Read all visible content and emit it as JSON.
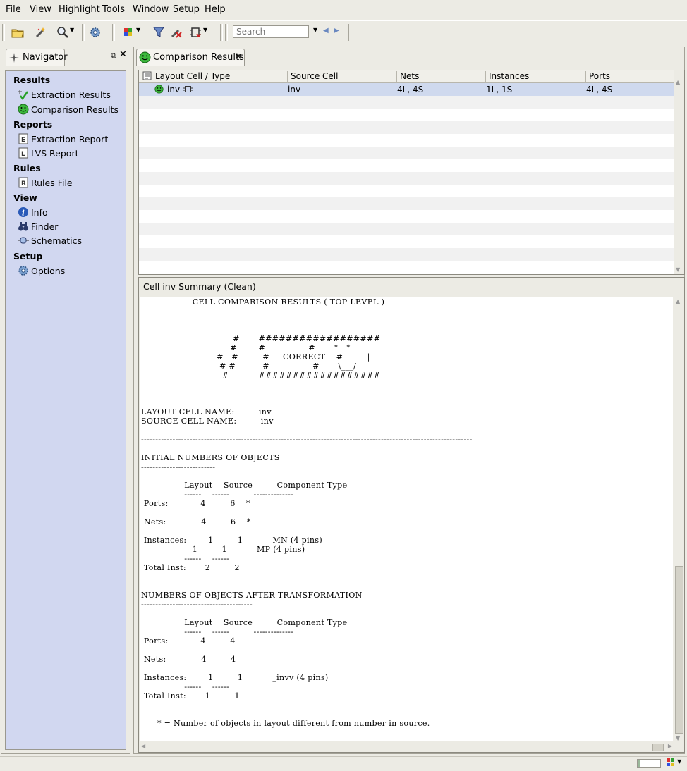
{
  "menu": [
    {
      "label": "File",
      "key": "F"
    },
    {
      "label": "View",
      "key": "V"
    },
    {
      "label": "Highlight",
      "key": "H"
    },
    {
      "label": "Tools",
      "key": "T"
    },
    {
      "label": "Window",
      "key": "W"
    },
    {
      "label": "Setup",
      "key": "S"
    },
    {
      "label": "Help",
      "key": "H"
    }
  ],
  "toolbar": {
    "search_placeholder": "Search"
  },
  "navigator": {
    "tab_label": "Navigator",
    "sections": {
      "results": "Results",
      "reports": "Reports",
      "rules": "Rules",
      "view": "View",
      "setup": "Setup"
    },
    "items": {
      "extraction_results": "Extraction Results",
      "comparison_results": "Comparison Results",
      "extraction_report": "Extraction Report",
      "lvs_report": "LVS Report",
      "rules_file": "Rules File",
      "info": "Info",
      "finder": "Finder",
      "schematics": "Schematics",
      "options": "Options"
    }
  },
  "comparison": {
    "tab_label": "Comparison Results",
    "columns": [
      "Layout Cell / Type",
      "Source Cell",
      "Nets",
      "Instances",
      "Ports"
    ],
    "rows": [
      {
        "layout_cell": "inv",
        "source_cell": "inv",
        "nets": "4L, 4S",
        "instances": "1L, 1S",
        "ports": "4L, 4S"
      }
    ]
  },
  "summary": {
    "title": "Cell inv Summary (Clean)",
    "report_text": "                   CELL COMPARISON RESULTS ( TOP LEVEL )\n\n\n\n                                  #       ##################       _   _\n                                 #        #                #       *   *\n                            #   #         #     CORRECT    #         |\n                             # #          #                #       \\___/\n                              #           ##################\n\n\n\nLAYOUT CELL NAME:         inv\nSOURCE CELL NAME:         inv\n\n--------------------------------------------------------------------------------------------------------------------\n\nINITIAL NUMBERS OF OBJECTS\n--------------------------\n\n                Layout    Source         Component Type\n                ------    ------         --------------\n Ports:            4         6    *\n\n Nets:             4         6    *\n\n Instances:        1         1           MN (4 pins)\n                   1         1           MP (4 pins)\n                ------    ------\n Total Inst:       2         2\n\n\nNUMBERS OF OBJECTS AFTER TRANSFORMATION\n---------------------------------------\n\n                Layout    Source         Component Type\n                ------    ------         --------------\n Ports:            4         4\n\n Nets:             4         4\n\n Instances:        1         1           _invv (4 pins)\n                ------    ------\n Total Inst:       1         1\n\n\n      * = Number of objects in layout different from number in source."
  }
}
